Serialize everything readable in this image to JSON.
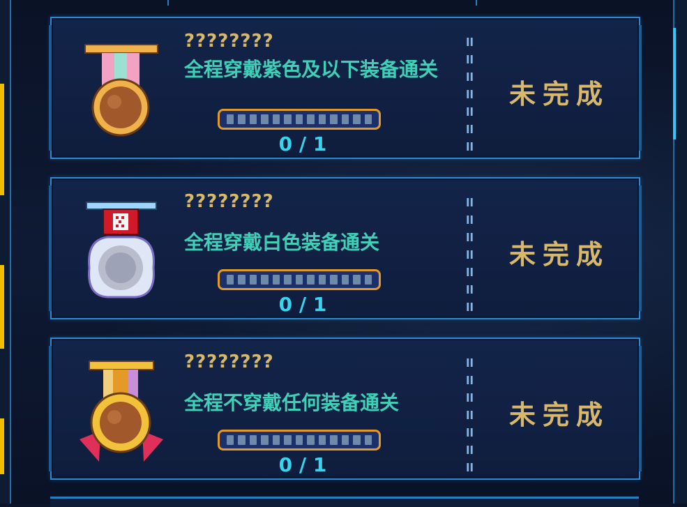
{
  "colors": {
    "accent": "#2a8ad6",
    "title": "#d8b86a",
    "desc": "#3fd0b8",
    "count": "#37d6f0",
    "bar_border": "#e59a28"
  },
  "achievements": [
    {
      "title": "????????",
      "desc": "全程穿戴紫色及以下装备通关",
      "progress": 0,
      "total": 1,
      "count_text": "0 / 1",
      "status": "未完成",
      "medal": "bronze-medal-icon"
    },
    {
      "title": "????????",
      "desc": "全程穿戴白色装备通关",
      "progress": 0,
      "total": 1,
      "count_text": "0 / 1",
      "status": "未完成",
      "medal": "silver-medal-icon"
    },
    {
      "title": "????????",
      "desc": "全程不穿戴任何装备通关",
      "progress": 0,
      "total": 1,
      "count_text": "0 / 1",
      "status": "未完成",
      "medal": "gold-medal-icon"
    }
  ]
}
